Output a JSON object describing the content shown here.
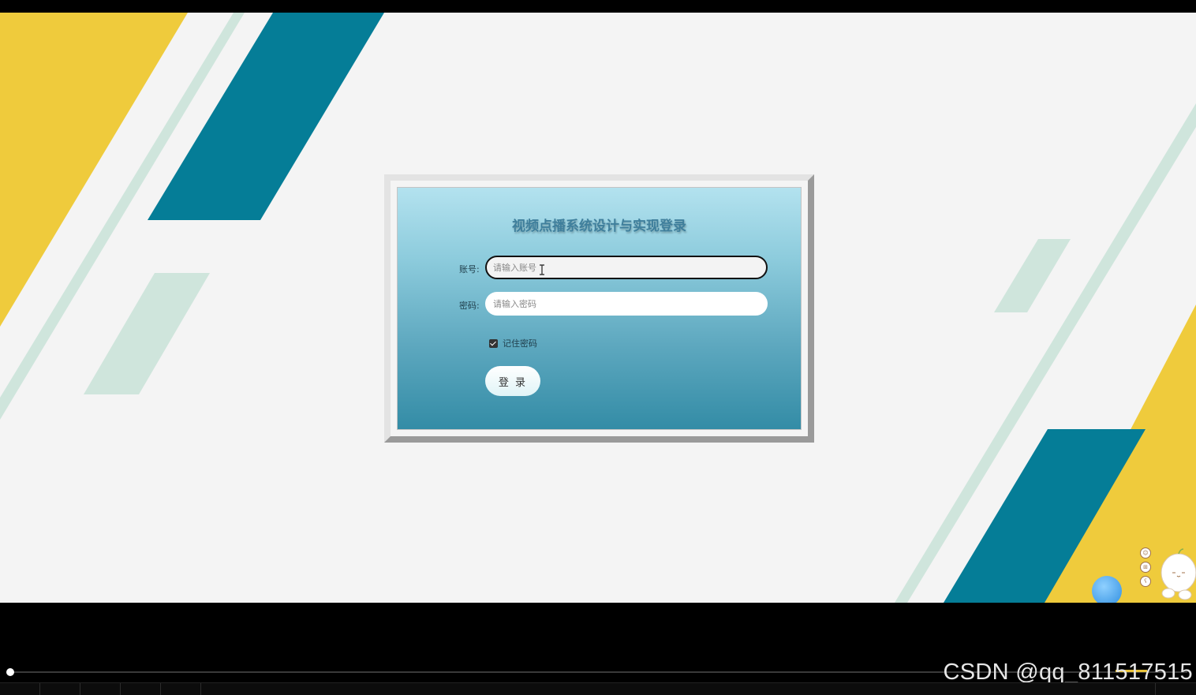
{
  "login": {
    "title": "视频点播系统设计与实现登录",
    "account_label": "账号:",
    "account_placeholder": "请输入账号",
    "password_label": "密码:",
    "password_placeholder": "请输入密码",
    "remember_label": "记住密码",
    "remember_checked": true,
    "login_button": "登 录"
  },
  "watermark": "CSDN @qq_811517515",
  "colors": {
    "yellow": "#efcb3c",
    "teal": "#057d97",
    "mint": "#cfe5dc",
    "background": "#f4f4f4"
  },
  "toolbar_icons": [
    "smile-icon",
    "grid-icon",
    "bear-icon"
  ]
}
